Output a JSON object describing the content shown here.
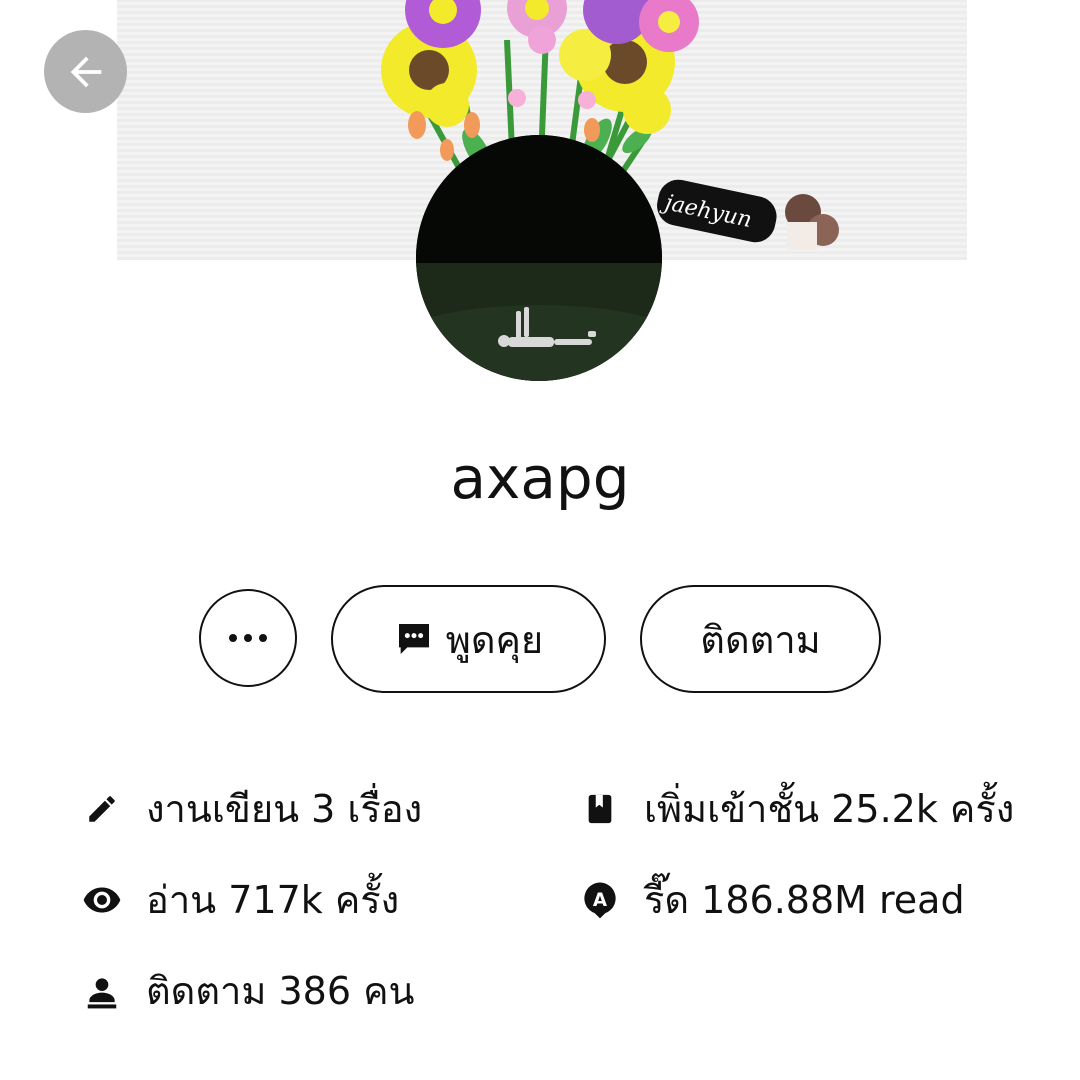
{
  "profile": {
    "username": "axapg",
    "cover_signature": "jaehyun"
  },
  "actions": {
    "more_icon": "more-horizontal-icon",
    "chat_label": "พูดคุย",
    "follow_label": "ติดตาม"
  },
  "stats": {
    "works": "งานเขียน 3 เรื่อง",
    "library_adds": "เพิ่มเข้าชั้น 25.2k ครั้ง",
    "reads": "อ่าน 717k ครั้ง",
    "reeds": "รี๊ด 186.88M read",
    "followers": "ติดตาม 386 คน"
  },
  "icons": {
    "back": "arrow-left-icon",
    "chat": "chat-bubble-icon",
    "works": "pencil-icon",
    "library": "bookmark-book-icon",
    "reads": "eye-icon",
    "reeds": "reed-bubble-icon",
    "followers": "follower-icon"
  },
  "colors": {
    "back_button_bg": "#b3b3b3",
    "text": "#111111",
    "background": "#ffffff"
  }
}
